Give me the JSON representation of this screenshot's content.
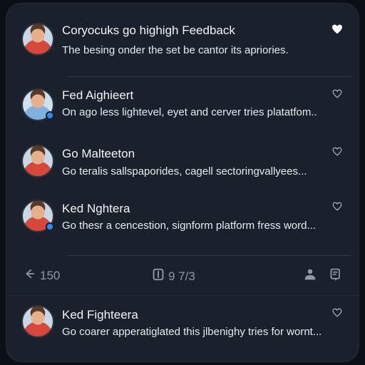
{
  "feed": {
    "items": [
      {
        "name": "Coryocuks go highigh Feedback",
        "message": "The besing onder the set be cantor its apriories.",
        "liked": true
      },
      {
        "name": "Fed Aighieert",
        "message": "On ago less lightevel, eyet and cerver tries platatfom..",
        "liked": false
      },
      {
        "name": "Go Malteeton",
        "message": "Go teralis sallspaporides, cagell sectoringvallyees...",
        "liked": false
      },
      {
        "name": "Ked Nghtera",
        "message": "Go thesr a cencestion, signform platform fress word...",
        "liked": false
      },
      {
        "name": "Ked Fighteera",
        "message": "Go coarer apperatiglated this jlbenighy tries for wornt...",
        "liked": false
      }
    ]
  },
  "stats": {
    "reply_count": "150",
    "view_count": "9 7/3"
  },
  "colors": {
    "accent": "#2f8cff",
    "panel": "#1a212c",
    "background": "#0b0f16"
  }
}
